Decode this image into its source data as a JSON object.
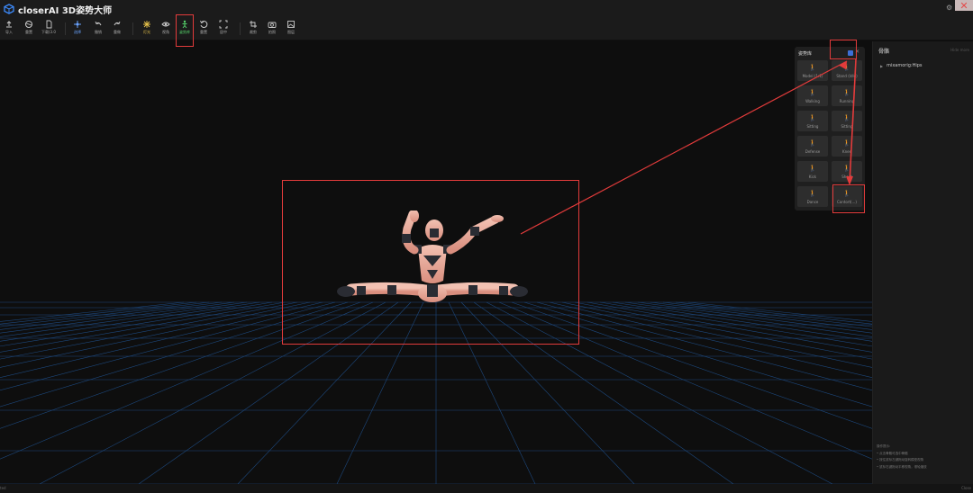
{
  "app": {
    "title": "closerAI 3D姿势大师"
  },
  "toolbar": [
    {
      "id": "import",
      "label": "导入"
    },
    {
      "id": "reset",
      "label": "重置"
    },
    {
      "id": "export",
      "label": "下载(3.0"
    },
    {
      "id": "move",
      "label": "选择"
    },
    {
      "id": "undo",
      "label": "撤销"
    },
    {
      "id": "redo",
      "label": "重做"
    },
    {
      "id": "light",
      "label": "灯光"
    },
    {
      "id": "view",
      "label": "视角"
    },
    {
      "id": "pose_lib",
      "label": "姿势库"
    },
    {
      "id": "rotate",
      "label": "重置"
    },
    {
      "id": "fit",
      "label": "居中"
    },
    {
      "id": "crop",
      "label": "裁剪"
    },
    {
      "id": "camera",
      "label": "拍照"
    },
    {
      "id": "image",
      "label": "图层"
    }
  ],
  "pose_panel": {
    "title": "姿势库",
    "items": [
      {
        "label": "Model (1:1)"
      },
      {
        "label": "Stand (Idle)"
      },
      {
        "label": "Walking"
      },
      {
        "label": "Running"
      },
      {
        "label": "Sitting"
      },
      {
        "label": "Sitting"
      },
      {
        "label": "Defense"
      },
      {
        "label": "Knee"
      },
      {
        "label": "Kick"
      },
      {
        "label": "Shoot"
      },
      {
        "label": "Dance"
      },
      {
        "label": "Contort(...)"
      }
    ]
  },
  "right_panel": {
    "title": "骨骼",
    "action": "Hide more",
    "tree_item": "mixamorig:Hips",
    "tips_title": "操作提示:",
    "tips": [
      "• 点击骨骼可选中骨骼",
      "• 按住鼠标左键拖动旋转模型视角",
      "• 鼠标右键拖动平移视角，滚轮缩放"
    ]
  },
  "statusbar": {
    "left": "ted",
    "right": "Close"
  },
  "colors": {
    "accent_blue": "#3d6fd8",
    "annotation_red": "#e23b3b",
    "active_green": "#55d36a",
    "grid_blue": "#1f4f8a"
  }
}
